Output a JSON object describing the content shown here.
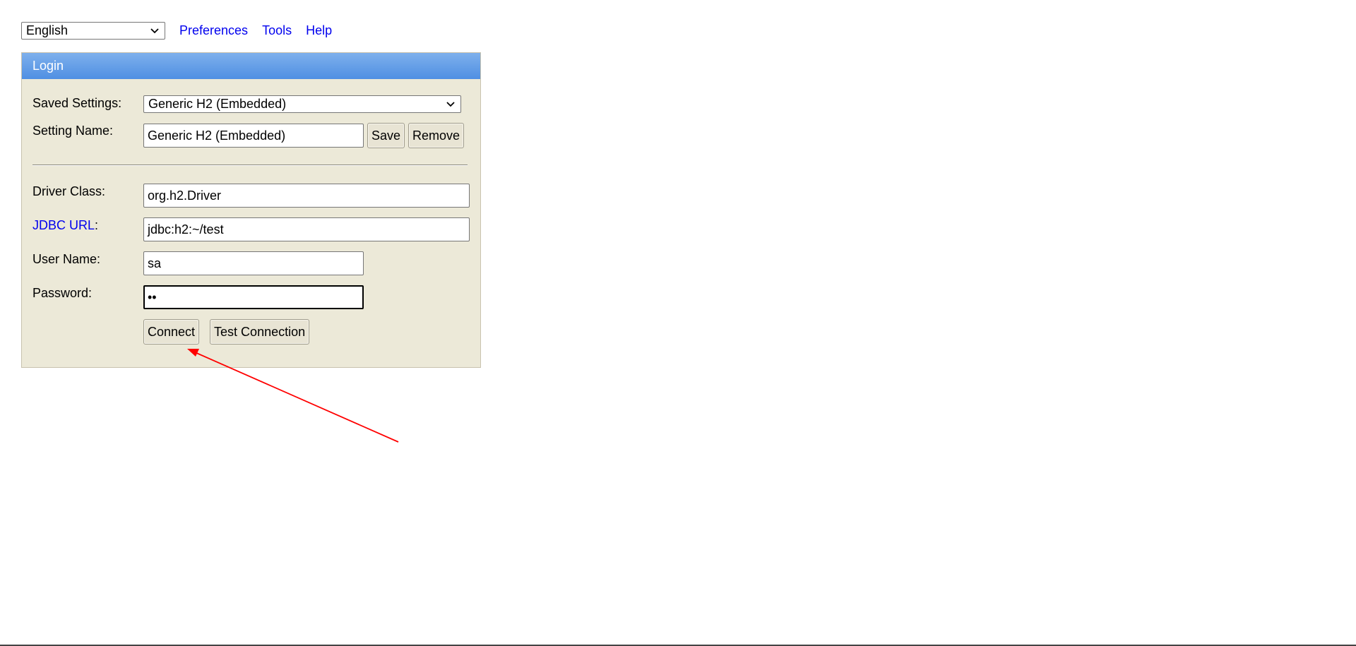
{
  "topbar": {
    "language": "English",
    "links": [
      "Preferences",
      "Tools",
      "Help"
    ]
  },
  "login": {
    "title": "Login",
    "saved_settings_label": "Saved Settings:",
    "saved_settings_value": "Generic H2 (Embedded)",
    "setting_name_label": "Setting Name:",
    "setting_name_value": "Generic H2 (Embedded)",
    "save_label": "Save",
    "remove_label": "Remove",
    "driver_class_label": "Driver Class:",
    "driver_class_value": "org.h2.Driver",
    "jdbc_url_label": "JDBC URL",
    "jdbc_url_colon": ":",
    "jdbc_url_value": "jdbc:h2:~/test",
    "user_name_label": "User Name:",
    "user_name_value": "sa",
    "password_label": "Password:",
    "password_value": "••",
    "connect_label": "Connect",
    "test_connection_label": "Test Connection"
  },
  "annotation": {
    "arrow_color": "#ff0000",
    "header_color": "#5b97e6",
    "panel_color": "#ece9d8",
    "link_color": "#0000ee"
  }
}
